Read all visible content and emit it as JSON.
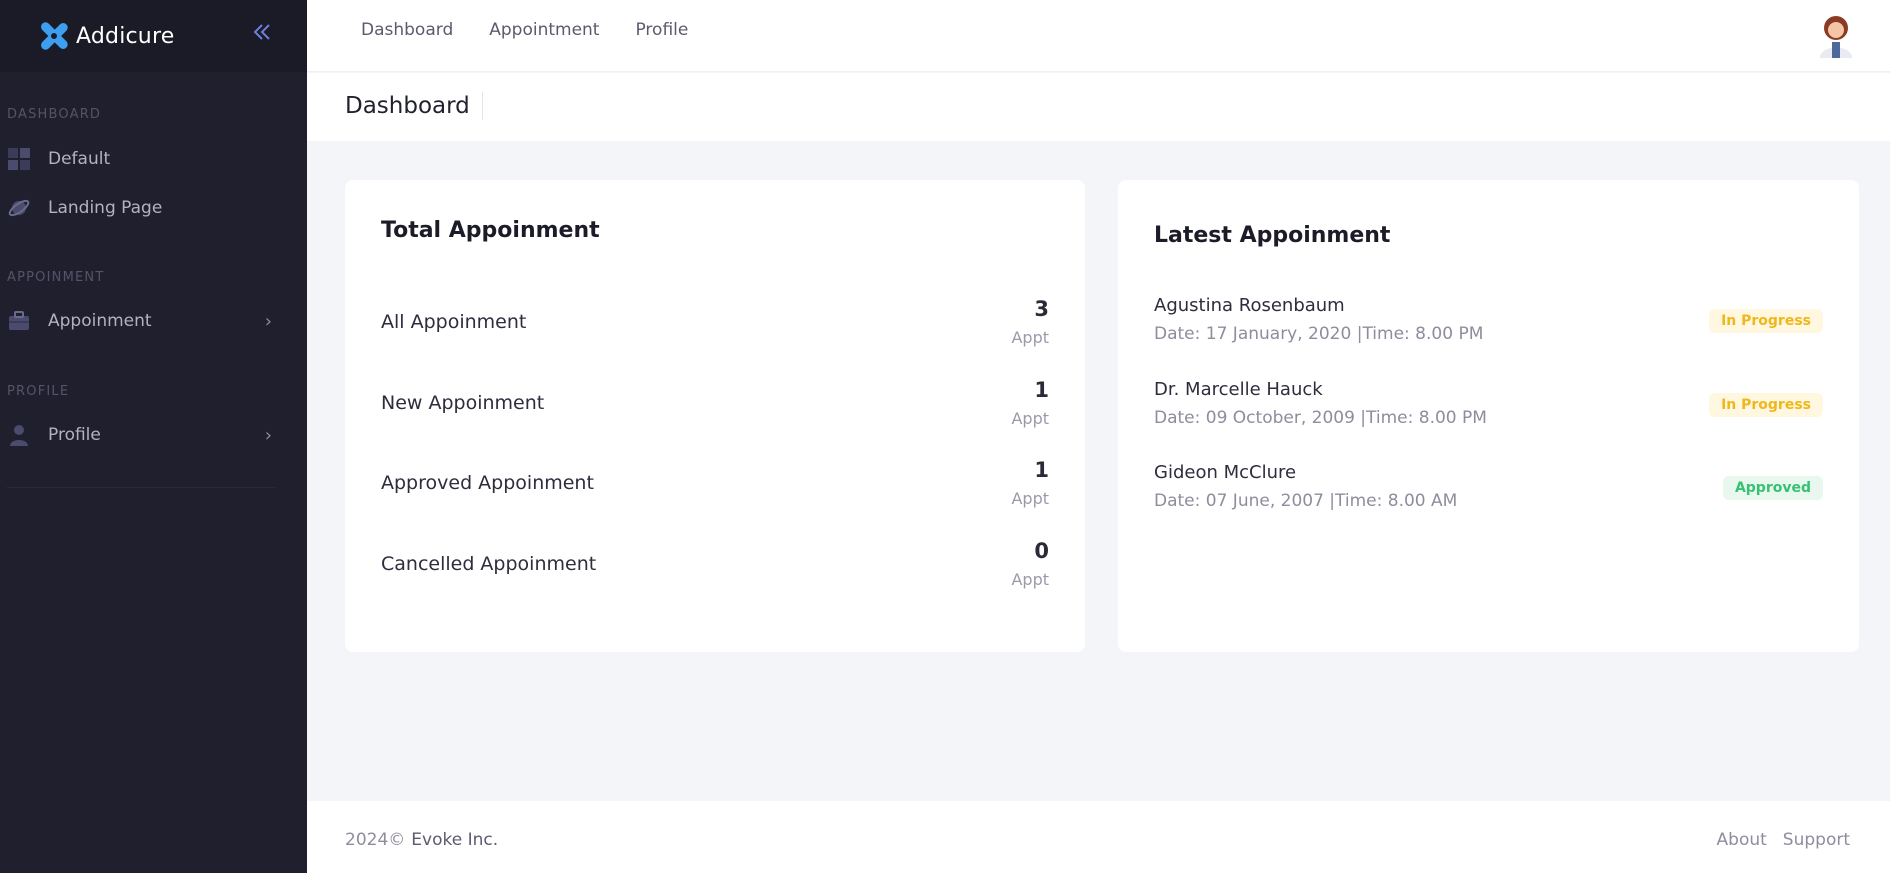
{
  "app": {
    "name": "Addicure",
    "collapse_icon": "double-chevron-left-icon"
  },
  "sidebar": {
    "sections": [
      {
        "title": "DASHBOARD",
        "items": [
          {
            "label": "Default",
            "icon": "grid-icon",
            "has_submenu": false
          },
          {
            "label": "Landing Page",
            "icon": "planet-icon",
            "has_submenu": false
          }
        ]
      },
      {
        "title": "APPOINMENT",
        "items": [
          {
            "label": "Appoinment",
            "icon": "briefcase-icon",
            "has_submenu": true
          }
        ]
      },
      {
        "title": "PROFILE",
        "items": [
          {
            "label": "Profile",
            "icon": "user-icon",
            "has_submenu": true
          }
        ]
      }
    ]
  },
  "topnav": {
    "items": [
      "Dashboard",
      "Appointment",
      "Profile"
    ]
  },
  "page": {
    "title": "Dashboard"
  },
  "total_card": {
    "title": "Total Appoinment",
    "rows": [
      {
        "label": "All Appoinment",
        "value": "3",
        "unit": "Appt"
      },
      {
        "label": "New Appoinment",
        "value": "1",
        "unit": "Appt"
      },
      {
        "label": "Approved Appoinment",
        "value": "1",
        "unit": "Appt"
      },
      {
        "label": "Cancelled Appoinment",
        "value": "0",
        "unit": "Appt"
      }
    ]
  },
  "latest_card": {
    "title": "Latest Appoinment",
    "items": [
      {
        "name": "Agustina Rosenbaum",
        "meta": "Date: 17 January, 2020 |Time: 8.00 PM",
        "status": "In Progress"
      },
      {
        "name": "Dr. Marcelle Hauck",
        "meta": "Date: 09 October, 2009 |Time: 8.00 PM",
        "status": "In Progress"
      },
      {
        "name": "Gideon McClure",
        "meta": "Date: 07 June, 2007 |Time: 8.00 AM",
        "status": "Approved"
      }
    ]
  },
  "footer": {
    "year": "2024©",
    "company": "Evoke Inc.",
    "links": [
      "About",
      "Support"
    ]
  },
  "colors": {
    "sidebar_bg": "#1f1f2e",
    "accent": "#6b7fd7",
    "in_progress": "#f0b71b",
    "approved": "#38c172"
  }
}
